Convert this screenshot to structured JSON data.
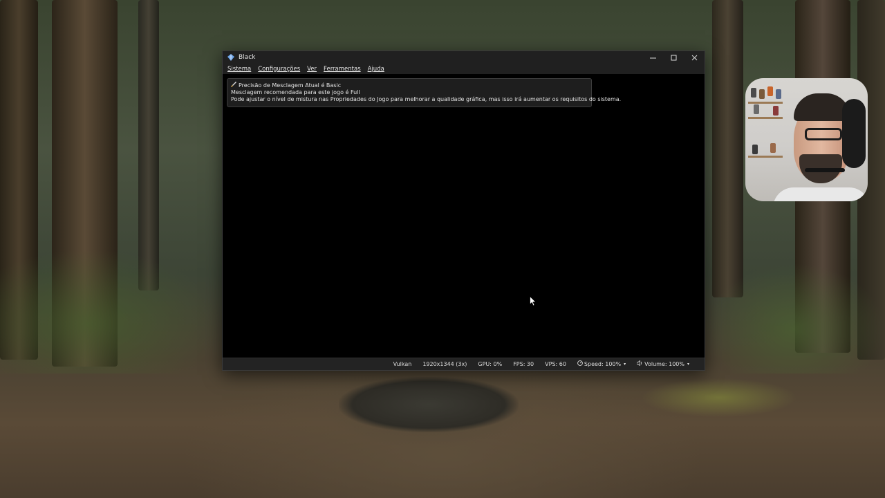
{
  "window": {
    "title": "Black",
    "controls": {
      "minimize": "—",
      "maximize": "☐",
      "close": "✕"
    }
  },
  "menu": [
    "Sistema",
    "Configurações",
    "Ver",
    "Ferramentas",
    "Ajuda"
  ],
  "notification": {
    "line1": "Precisão de Mesclagem Atual é Basic",
    "line2": "Mesclagem recomendada para este jogo é Full",
    "line3": "Pode ajustar o nível de mistura nas Propriedades do Jogo para melhorar a qualidade gráfica, mas isso irá aumentar os requisitos do sistema."
  },
  "status": {
    "renderer": "Vulkan",
    "resolution": "1920x1344 (3x)",
    "gpu": "GPU: 0%",
    "fps": "FPS: 30",
    "vps": "VPS: 60",
    "speed": "Speed: 100%",
    "volume": "Volume: 100%"
  },
  "icons": {
    "app": "diamond-app-icon",
    "brush": "brush-icon",
    "speed": "speedometer-icon",
    "volume": "speaker-icon"
  }
}
